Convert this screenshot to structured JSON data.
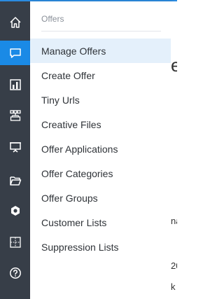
{
  "rail": {
    "items": [
      {
        "icon": "home-icon"
      },
      {
        "icon": "chat-icon"
      },
      {
        "icon": "bar-chart-icon"
      },
      {
        "icon": "hierarchy-icon"
      },
      {
        "icon": "presentation-icon"
      },
      {
        "icon": "folder-icon"
      },
      {
        "icon": "hexagon-icon"
      },
      {
        "icon": "grid-icon"
      },
      {
        "icon": "help-icon"
      }
    ]
  },
  "menu": {
    "header": "Offers",
    "items": [
      {
        "label": "Manage Offers"
      },
      {
        "label": "Create Offer"
      },
      {
        "label": "Tiny Urls"
      },
      {
        "label": "Creative Files"
      },
      {
        "label": "Offer Applications"
      },
      {
        "label": "Offer Categories"
      },
      {
        "label": "Offer Groups"
      },
      {
        "label": "Customer Lists"
      },
      {
        "label": "Suppression Lists"
      }
    ]
  },
  "background": {
    "frag_1": "e",
    "frag_2": "na",
    "frag_3": "20",
    "frag_4": "k"
  },
  "colors": {
    "rail_bg": "#373e48",
    "accent": "#1a8ae6",
    "active_item_bg": "#e4f0fb"
  }
}
